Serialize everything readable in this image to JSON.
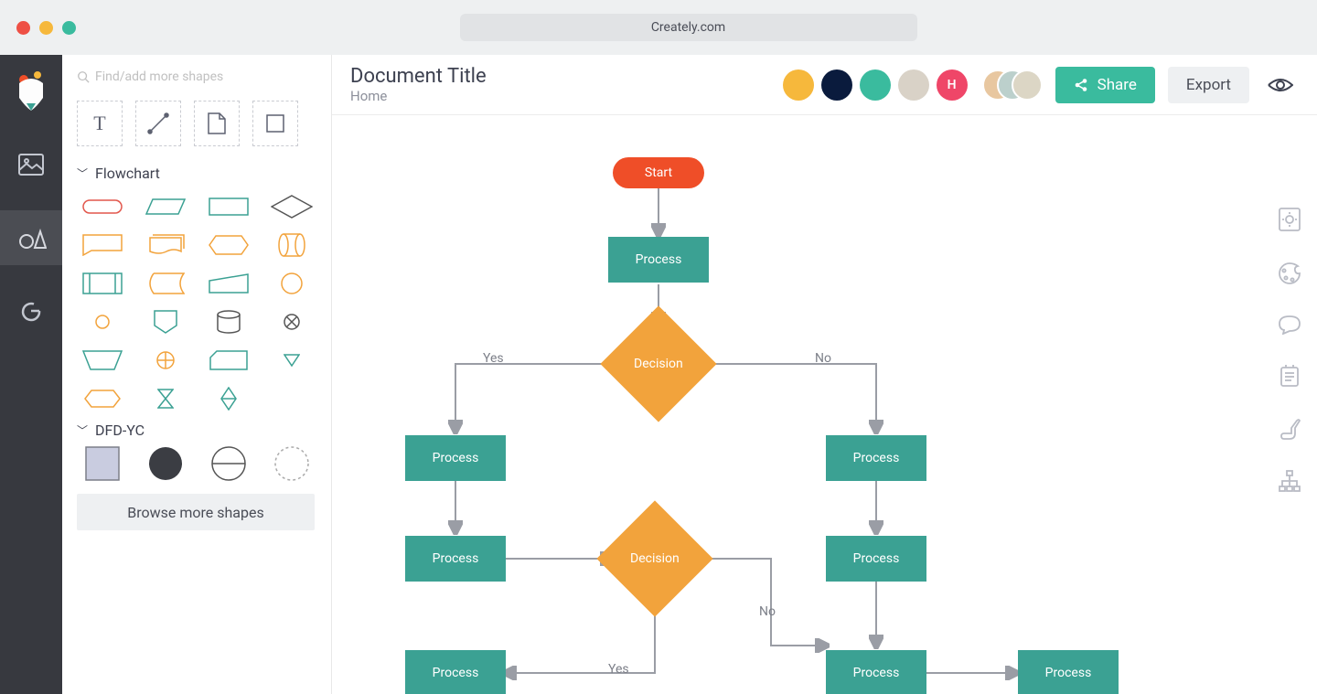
{
  "browser": {
    "url": "Creately.com"
  },
  "sidebar": {
    "search_placeholder": "Find/add more shapes",
    "sections": {
      "flowchart": "Flowchart",
      "dfd": "DFD-YC"
    },
    "browse_label": "Browse more shapes"
  },
  "header": {
    "title": "Document Title",
    "breadcrumb": "Home",
    "share_label": "Share",
    "export_label": "Export",
    "avatars": [
      {
        "id": "a1",
        "bg": "#f6b83c"
      },
      {
        "id": "a2",
        "bg": "#0a1b3d"
      },
      {
        "id": "a3",
        "bg": "#3abb9e"
      },
      {
        "id": "a4",
        "bg": "#d9d2c7"
      },
      {
        "id": "a5",
        "bg": "#ef4668",
        "letter": "H"
      }
    ]
  },
  "canvas": {
    "nodes": {
      "start": "Start",
      "process1": "Process",
      "decision1": "Decision",
      "processL1": "Process",
      "processR1": "Process",
      "processL2": "Process",
      "processR2": "Process",
      "decision2": "Decision",
      "processBL": "Process",
      "processBM": "Process",
      "processBR": "Process"
    },
    "edge_labels": {
      "yes1": "Yes",
      "no1": "No",
      "yes2": "Yes",
      "no2": "No"
    }
  },
  "colors": {
    "accent_teal": "#3ba193",
    "accent_orange": "#f2a33c",
    "accent_red": "#ef4e28",
    "share_green": "#3abb9e"
  }
}
